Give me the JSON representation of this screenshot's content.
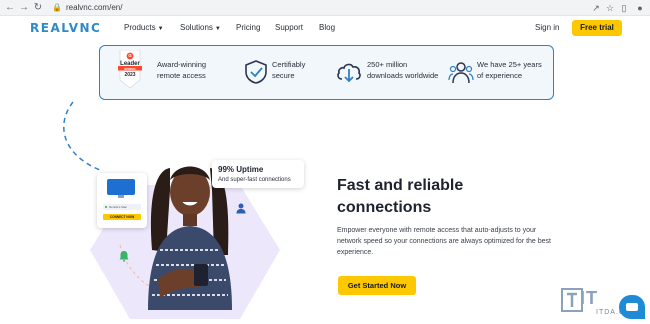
{
  "browser": {
    "url": "realvnc.com/en/",
    "icons": [
      "back-icon",
      "forward-icon",
      "reload-icon",
      "lock-icon",
      "share-icon",
      "star-icon",
      "extensions-icon",
      "sidebar-icon",
      "profile-icon"
    ]
  },
  "header": {
    "logo": "REALVNC",
    "nav": [
      {
        "label": "Products",
        "has_caret": true
      },
      {
        "label": "Solutions",
        "has_caret": true
      },
      {
        "label": "Pricing",
        "has_caret": false
      },
      {
        "label": "Support",
        "has_caret": false
      },
      {
        "label": "Blog",
        "has_caret": false
      }
    ],
    "signin": "Sign in",
    "free_trial": "Free trial"
  },
  "awards": {
    "badge": {
      "brand": "G",
      "title": "Leader",
      "ribbon": "SPRING",
      "year": "2023"
    },
    "items": [
      {
        "icon": "g2-badge-icon",
        "line1": "Award-winning",
        "line2": "remote access"
      },
      {
        "icon": "shield-check-icon",
        "line1": "Certifiably",
        "line2": "secure"
      },
      {
        "icon": "cloud-download-icon",
        "line1": "250+ million",
        "line2": "downloads worldwide"
      },
      {
        "icon": "users-icon",
        "line1": "We have 25+ years",
        "line2": "of experience"
      }
    ]
  },
  "hero": {
    "uptime_title": "99% Uptime",
    "uptime_sub": "And super-fast connections",
    "device_row": "Dentist's Mac",
    "device_connect": "CONNECT NOW",
    "headline": "Fast and reliable connections",
    "body": "Empower everyone with remote access that auto-adjusts to your network speed so your connections are always optimized for the best experience.",
    "cta": "Get Started Now"
  },
  "watermark": {
    "big": "IT",
    "small": "ITDA.CN"
  },
  "colors": {
    "accent_yellow": "#fdc800",
    "brand_blue": "#2d8ac9",
    "border_blue": "#2f80c4",
    "blob_lavender": "#ece7fb"
  }
}
